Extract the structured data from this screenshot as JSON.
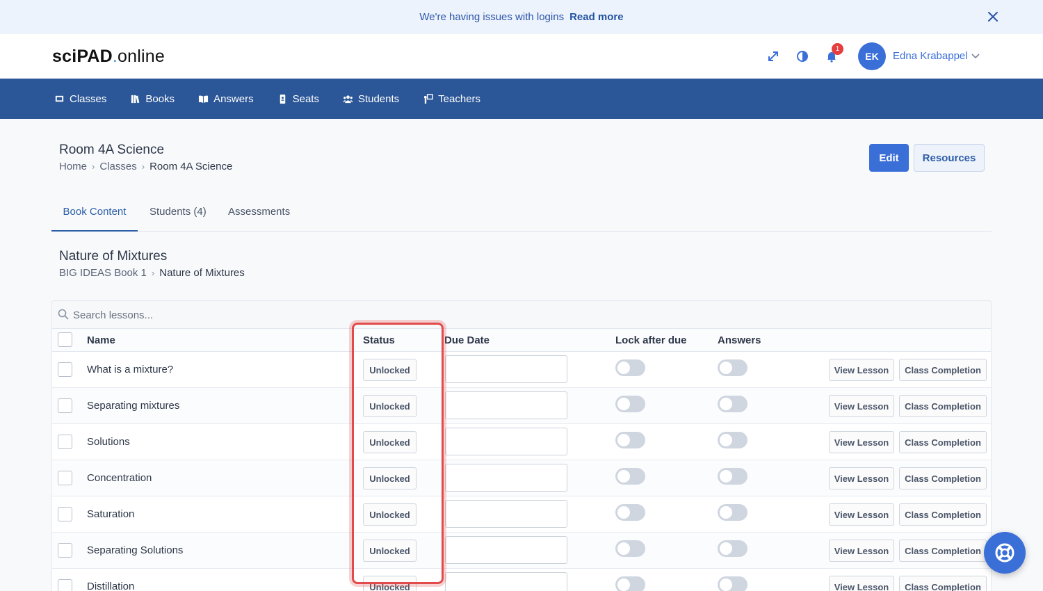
{
  "banner": {
    "message": "We're having issues with logins",
    "link": "Read more"
  },
  "logo": {
    "brand_bold": "sciPAD",
    "dot": ".",
    "brand_light": "online"
  },
  "user": {
    "initials": "EK",
    "name": "Edna Krabappel",
    "notifications": "1"
  },
  "nav": {
    "items": [
      {
        "label": "Classes",
        "icon": "classes-icon"
      },
      {
        "label": "Books",
        "icon": "books-icon"
      },
      {
        "label": "Answers",
        "icon": "answers-icon"
      },
      {
        "label": "Seats",
        "icon": "seats-icon"
      },
      {
        "label": "Students",
        "icon": "students-icon"
      },
      {
        "label": "Teachers",
        "icon": "teachers-icon"
      }
    ]
  },
  "page": {
    "title": "Room 4A Science",
    "breadcrumb": [
      "Home",
      "Classes",
      "Room 4A Science"
    ],
    "edit_label": "Edit",
    "resources_label": "Resources"
  },
  "tabs": [
    {
      "label": "Book Content",
      "active": true
    },
    {
      "label": "Students (4)",
      "active": false
    },
    {
      "label": "Assessments",
      "active": false
    }
  ],
  "section": {
    "title": "Nature of Mixtures",
    "breadcrumb": [
      "BIG IDEAS Book 1",
      "Nature of Mixtures"
    ]
  },
  "table": {
    "search_placeholder": "Search lessons...",
    "headers": {
      "name": "Name",
      "status": "Status",
      "due_date": "Due Date",
      "lock": "Lock after due",
      "answers": "Answers"
    },
    "view_label": "View Lesson",
    "completion_label": "Class Completion",
    "rows": [
      {
        "name": "What is a mixture?",
        "status": "Unlocked",
        "due_date": "",
        "lock_after_due": false,
        "answers": false
      },
      {
        "name": "Separating mixtures",
        "status": "Unlocked",
        "due_date": "",
        "lock_after_due": false,
        "answers": false
      },
      {
        "name": "Solutions",
        "status": "Unlocked",
        "due_date": "",
        "lock_after_due": false,
        "answers": false
      },
      {
        "name": "Concentration",
        "status": "Unlocked",
        "due_date": "",
        "lock_after_due": false,
        "answers": false
      },
      {
        "name": "Saturation",
        "status": "Unlocked",
        "due_date": "",
        "lock_after_due": false,
        "answers": false
      },
      {
        "name": "Separating Solutions",
        "status": "Unlocked",
        "due_date": "",
        "lock_after_due": false,
        "answers": false
      },
      {
        "name": "Distillation",
        "status": "Unlocked",
        "due_date": "",
        "lock_after_due": false,
        "answers": false
      }
    ]
  },
  "colors": {
    "primary": "#3b6fd8",
    "nav_bg": "#2b5697",
    "highlight": "#e24b4b"
  }
}
